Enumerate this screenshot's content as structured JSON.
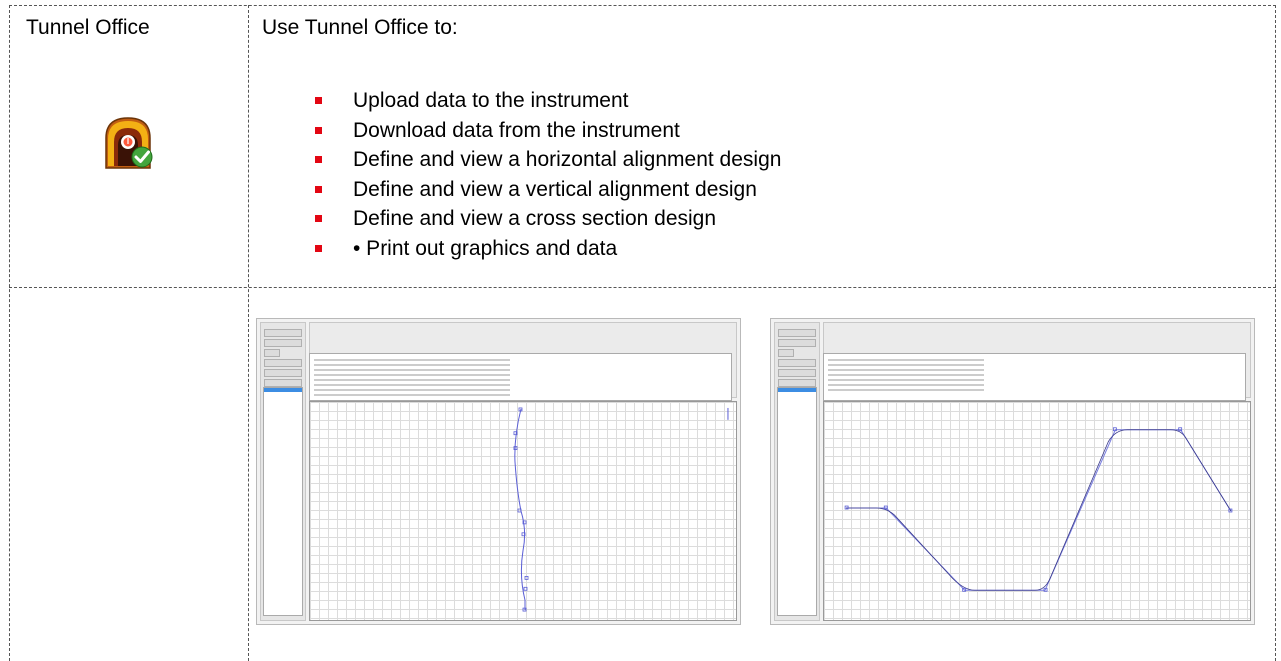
{
  "left_column": {
    "title": "Tunnel Office",
    "icon": "tunnel-app-icon"
  },
  "right_column": {
    "heading": "Use Tunnel Office to:",
    "bullets": [
      "Upload data to the instrument",
      "Download data from the instrument",
      "Define and view a horizontal alignment design",
      "Define and view a vertical alignment design",
      "Define and view a cross section design",
      "• Print out graphics and data"
    ],
    "bullet_color": "#e30613"
  },
  "screenshots": [
    {
      "name": "horizontal-alignment-screenshot"
    },
    {
      "name": "vertical-alignment-screenshot"
    }
  ]
}
